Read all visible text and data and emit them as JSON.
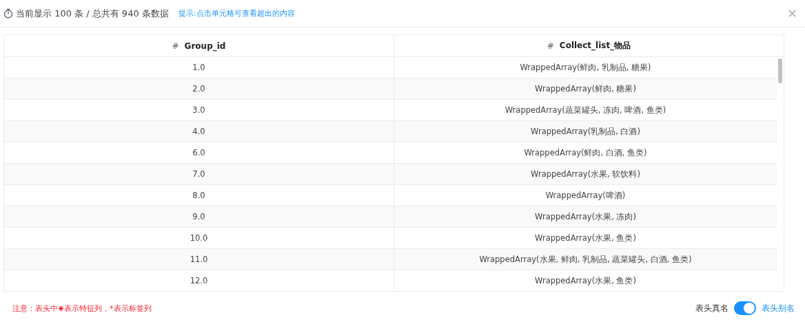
{
  "header": {
    "summary": "当前显示 100 条 / 总共有 940 条数据",
    "hint": "提示:点击单元格可查看超出的内容"
  },
  "table": {
    "columns": [
      {
        "mark": "#",
        "label": "Group_id"
      },
      {
        "mark": "#",
        "label": "Collect_list_物品"
      }
    ],
    "rows": [
      [
        "1.0",
        "WrappedArray(鲜肉, 乳制品, 糖果)"
      ],
      [
        "2.0",
        "WrappedArray(鲜肉, 糖果)"
      ],
      [
        "3.0",
        "WrappedArray(蔬菜罐头, 冻肉, 啤酒, 鱼类)"
      ],
      [
        "4.0",
        "WrappedArray(乳制品, 白酒)"
      ],
      [
        "6.0",
        "WrappedArray(鲜肉, 白酒, 鱼类)"
      ],
      [
        "7.0",
        "WrappedArray(水果, 软饮料)"
      ],
      [
        "8.0",
        "WrappedArray(啤酒)"
      ],
      [
        "9.0",
        "WrappedArray(水果, 冻肉)"
      ],
      [
        "10.0",
        "WrappedArray(水果, 鱼类)"
      ],
      [
        "11.0",
        "WrappedArray(水果, 鲜肉, 乳制品, 蔬菜罐头, 白酒, 鱼类)"
      ],
      [
        "12.0",
        "WrappedArray(水果, 鱼类)"
      ]
    ]
  },
  "note": {
    "before": "注意：表头中",
    "after": "表示特征列，*表示标签列"
  },
  "switch": {
    "off_label": "表头真名",
    "on_label": "表头别名",
    "on": true
  }
}
